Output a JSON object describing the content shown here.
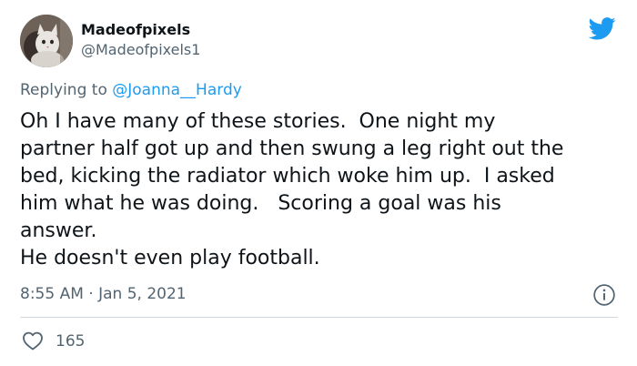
{
  "author": {
    "display_name": "Madeofpixels",
    "handle": "@Madeofpixels1",
    "avatar_icon": "cat-avatar"
  },
  "reply": {
    "prefix": "Replying to ",
    "to_handle": "@Joanna__Hardy"
  },
  "tweet": {
    "lines": [
      "Oh I have many of these stories.  One night my",
      "partner half got up and then swung a leg right out the",
      "bed, kicking the radiator which woke him up.  I asked",
      "him what he was doing.   Scoring a goal was his",
      "answer.",
      "He doesn't even play football."
    ]
  },
  "meta": {
    "timestamp": "8:55 AM · Jan 5, 2021"
  },
  "stats": {
    "likes": "165"
  },
  "icons": {
    "brand": "twitter-bird-icon",
    "info": "info-icon",
    "like": "heart-icon"
  },
  "colors": {
    "brand": "#1d9bf0",
    "secondary_text": "#536471",
    "primary_text": "#0f1419",
    "divider": "#cfd9de"
  }
}
